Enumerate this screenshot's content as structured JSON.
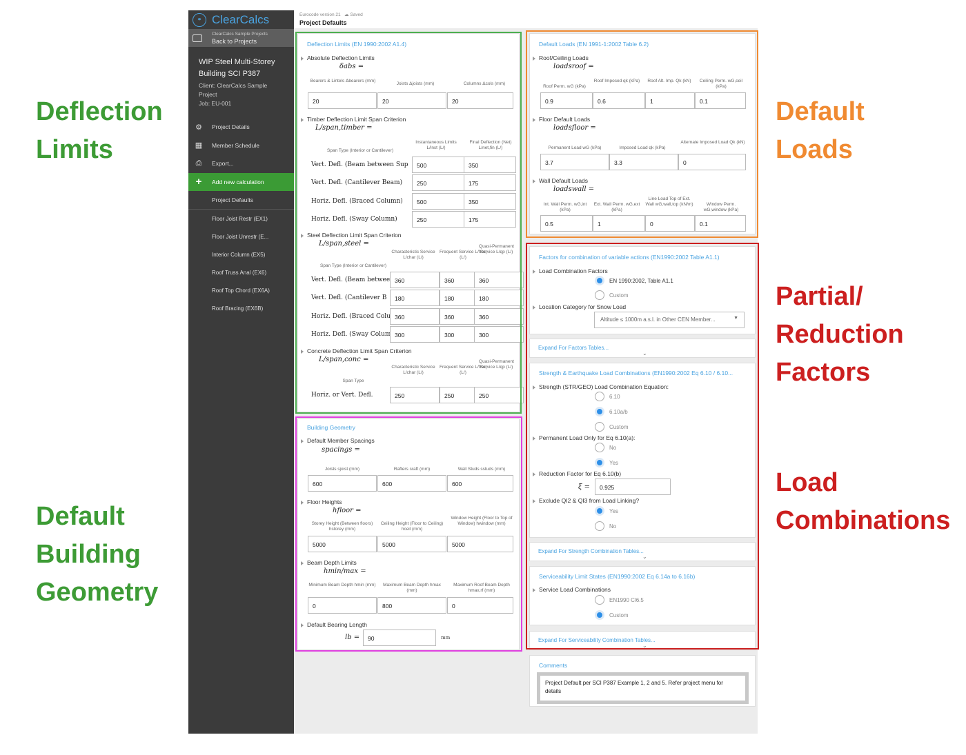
{
  "annotations": {
    "deflection": [
      "Deflection",
      "Limits"
    ],
    "geometry": [
      "Default",
      "Building",
      "Geometry"
    ],
    "loads": [
      "Default",
      "Loads"
    ],
    "factors": [
      "Partial/",
      "Reduction",
      "Factors"
    ],
    "combos": [
      "Load",
      "Combinations"
    ]
  },
  "colors": {
    "green": "#3d9b35",
    "orange": "#f08a31",
    "red": "#cc1f1f",
    "magenta": "#e040e0",
    "accent": "#4aa3e0"
  },
  "sidebar": {
    "brand": "ClearCalcs",
    "back_small": "ClearCalcs Sample Projects",
    "back_label": "Back to Projects",
    "project_title_1": "WIP Steel Multi-Storey",
    "project_title_2": "Building SCI P387",
    "client": "Client: ClearCalcs Sample",
    "client2": "Project",
    "job": "Job: EU-001",
    "nav": [
      {
        "icon": "⚙",
        "label": "Project Details"
      },
      {
        "icon": "▦",
        "label": "Member Schedule"
      },
      {
        "icon": "⎙",
        "label": "Export..."
      },
      {
        "icon": "+",
        "label": "Add new calculation"
      }
    ],
    "project_defaults": "Project Defaults",
    "calcs": [
      "Floor Joist Restr (EX1)",
      "Floor Joist Unrestr (E...",
      "Interior Column (EX5)",
      "Roof Truss Anal (EX6)",
      "Roof Top Chord (EX6A)",
      "Roof Bracing (EX6B)"
    ]
  },
  "header": {
    "crumb": "Eurocode version 21",
    "crumb2": "Saved",
    "title": "Project Defaults"
  },
  "deflection": {
    "title": "Deflection Limits (EN 1990:2002 A1.4)",
    "absolute_label": "Absolute Deflection Limits",
    "absolute_sym": "δabs =",
    "abs_headers": [
      "Bearers & Lintels Δbearers (mm)",
      "Joists Δjoists (mm)",
      "Columns Δcols (mm)"
    ],
    "abs_values": [
      "20",
      "20",
      "20"
    ],
    "timber_label": "Timber Deflection Limit Span Criterion",
    "timber_sym": "L/span,timber =",
    "timber_headers": [
      "Span Type (Interior or Cantilever)",
      "Instantaneous Limits L/inst (L/)",
      "Final Deflection (Net) L/net,fin (L/)"
    ],
    "timber_rows": [
      {
        "label": "Vert. Defl. (Beam between Sup",
        "v": [
          "500",
          "350"
        ]
      },
      {
        "label": "Vert. Defl. (Cantilever Beam)",
        "v": [
          "250",
          "175"
        ]
      },
      {
        "label": "Horiz. Defl. (Braced Column)",
        "v": [
          "500",
          "350"
        ]
      },
      {
        "label": "Horiz. Defl. (Sway Column)",
        "v": [
          "250",
          "175"
        ]
      }
    ],
    "steel_label": "Steel Deflection Limit Span Criterion",
    "steel_sym": "L/span,steel =",
    "steel_headers": [
      "Span Type (Interior or Cantilever)",
      "Characteristic Service L/char (L/)",
      "Frequent Service L/freq (L/)",
      "Quasi-Permanent Service L/qp (L/)"
    ],
    "steel_rows": [
      {
        "label": "Vert. Defl. (Beam betwee",
        "v": [
          "360",
          "360",
          "360"
        ]
      },
      {
        "label": "Vert. Defl. (Cantilever B",
        "v": [
          "180",
          "180",
          "180"
        ]
      },
      {
        "label": "Horiz. Defl. (Braced Colu",
        "v": [
          "360",
          "360",
          "360"
        ]
      },
      {
        "label": "Horiz. Defl. (Sway Colum",
        "v": [
          "300",
          "300",
          "300"
        ]
      }
    ],
    "concrete_label": "Concrete Deflection Limit Span Criterion",
    "concrete_sym": "L/span,conc =",
    "concrete_headers": [
      "Span Type",
      "Characteristic Service L/char (L/)",
      "Frequent Service L/freq (L/)",
      "Quasi-Permanent Service L/qp (L/)"
    ],
    "concrete_rows": [
      {
        "label": "Horiz. or Vert. Defl.",
        "v": [
          "250",
          "250",
          "250"
        ]
      }
    ]
  },
  "geometry": {
    "title": "Building Geometry",
    "spacing_label": "Default Member Spacings",
    "spacing_sym": "spacings =",
    "spacing_headers": [
      "Joists sjoist (mm)",
      "Rafters sraft (mm)",
      "Wall Studs sstuds (mm)"
    ],
    "spacing_values": [
      "600",
      "600",
      "600"
    ],
    "heights_label": "Floor Heights",
    "heights_sym": "hfloor =",
    "heights_headers": [
      "Storey Height (Between floors) hstorey (mm)",
      "Ceiling Height (Floor to Ceiling) hceil (mm)",
      "Window Height (Floor to Top of Window) hwindow (mm)"
    ],
    "heights_values": [
      "5000",
      "5000",
      "5000"
    ],
    "depth_label": "Beam Depth Limits",
    "depth_sym": "hmin/max =",
    "depth_headers": [
      "Minimum Beam Depth hmin (mm)",
      "Maximum Beam Depth hmax (mm)",
      "Maximum Roof Beam Depth hmax,rf (mm)"
    ],
    "depth_values": [
      "0",
      "800",
      "0"
    ],
    "bearing_label": "Default Bearing Length",
    "bearing_sym": "lb =",
    "bearing_value": "90",
    "bearing_unit": "mm"
  },
  "loads": {
    "title": "Default Loads (EN 1991-1:2002 Table 6.2)",
    "roof_label": "Roof/Ceiling Loads",
    "roof_sym": "loadsroof =",
    "roof_headers": [
      "Roof Perm. wG (kPa)",
      "Roof Imposed qk (kPa)",
      "Roof Alt. Imp. Qk (kN)",
      "Ceiling Perm. wG,ceil (kPa)"
    ],
    "roof_values": [
      "0.9",
      "0.6",
      "1",
      "0.1"
    ],
    "floor_label": "Floor Default Loads",
    "floor_sym": "loadsfloor =",
    "floor_headers": [
      "Permanent Load wG (kPa)",
      "Imposed Load qk (kPa)",
      "Alternate Imposed Load Qk (kN)"
    ],
    "floor_values": [
      "3.7",
      "3.3",
      "0"
    ],
    "wall_label": "Wall Default Loads",
    "wall_sym": "loadswall =",
    "wall_headers": [
      "Int. Wall Perm. wG,int (kPa)",
      "Ext. Wall Perm. wG,ext (kPa)",
      "Line Load Top of Ext. Wall wG,wall,top (kN/m)",
      "Window Perm. wG,window (kPa)"
    ],
    "wall_values": [
      "0.5",
      "1",
      "0",
      "0.1"
    ]
  },
  "factors": {
    "title": "Factors for combination of variable actions (EN1990:2002 Table A1.1)",
    "lcf_label": "Load Combination Factors",
    "lcf_options": [
      "EN 1990:2002, Table A1.1",
      "Custom"
    ],
    "snow_label": "Location Category for Snow Load",
    "snow_value": "Altitude ≤ 1000m a.s.l. in Other CEN Member...",
    "expand_factors": "Expand For Factors Tables..."
  },
  "combos": {
    "title": "Strength & Earthquake Load Combinations (EN1990:2002 Eq 6.10 / 6.10...",
    "eq_label": "Strength (STR/GEO) Load Combination Equation:",
    "eq_options": [
      "6.10",
      "6.10a/b",
      "Custom"
    ],
    "perm_label": "Permanent Load Only for Eq 6.10(a):",
    "perm_options": [
      "No",
      "Yes"
    ],
    "xi_label": "Reduction Factor for Eq 6.10(b)",
    "xi_sym": "ξ =",
    "xi_value": "0.925",
    "excl_label": "Exclude QI2 & QI3 from Load Linking?",
    "excl_options": [
      "Yes",
      "No"
    ],
    "expand_strength": "Expand For Strength Combination Tables...",
    "sls_title": "Serviceability Limit States (EN1990:2002 Eq 6.14a to 6.16b)",
    "sls_label": "Service Load Combinations",
    "sls_options": [
      "EN1990 Cl6.5",
      "Custom"
    ],
    "expand_sls": "Expand For Serviceability Combination Tables..."
  },
  "comments": {
    "title": "Comments",
    "text": "Project Default per SCI P387 Example 1, 2 and 5. Refer project menu for details"
  }
}
